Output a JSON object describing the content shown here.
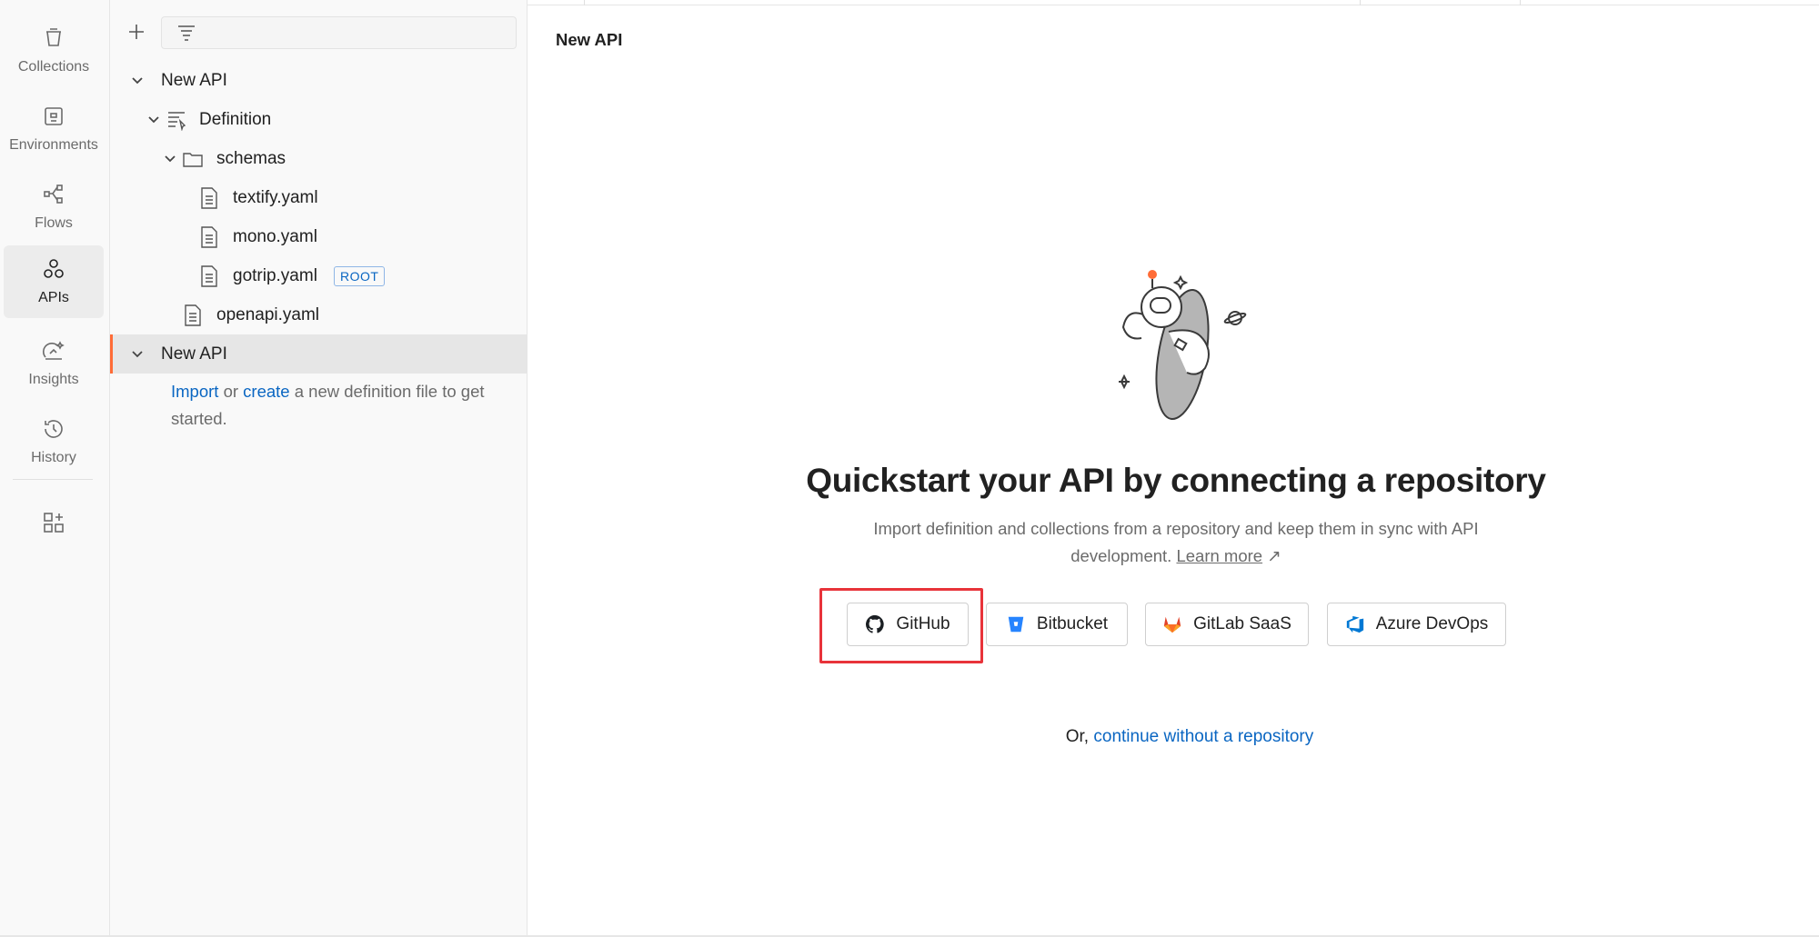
{
  "rail": {
    "items": [
      {
        "label": "Collections",
        "icon": "collections-icon"
      },
      {
        "label": "Environments",
        "icon": "environments-icon"
      },
      {
        "label": "Flows",
        "icon": "flows-icon"
      },
      {
        "label": "APIs",
        "icon": "apis-icon",
        "active": true
      },
      {
        "label": "Insights",
        "icon": "insights-icon"
      },
      {
        "label": "History",
        "icon": "history-icon"
      }
    ],
    "extra_icon": "add-workbench-icon"
  },
  "sidebar": {
    "filter_placeholder": "",
    "tree": [
      {
        "label": "New API",
        "expanded": true
      },
      {
        "label": "Definition",
        "expanded": true
      },
      {
        "label": "schemas",
        "expanded": true
      },
      {
        "label": "textify.yaml"
      },
      {
        "label": "mono.yaml"
      },
      {
        "label": "gotrip.yaml",
        "badge": "ROOT"
      },
      {
        "label": "openapi.yaml"
      },
      {
        "label": "New API",
        "expanded": true,
        "selected": true
      }
    ],
    "hint": {
      "import": "Import",
      "or": " or ",
      "create": "create",
      "rest": " a new definition file to get started."
    }
  },
  "main": {
    "title": "New API",
    "headline": "Quickstart your API by connecting a repository",
    "subtext": "Import definition and collections from a repository and keep them in sync with API development.",
    "learn_more": "Learn more",
    "learn_more_arrow": "↗",
    "buttons": [
      {
        "label": "GitHub",
        "icon": "github-icon"
      },
      {
        "label": "Bitbucket",
        "icon": "bitbucket-icon"
      },
      {
        "label": "GitLab SaaS",
        "icon": "gitlab-icon"
      },
      {
        "label": "Azure DevOps",
        "icon": "azure-devops-icon"
      }
    ],
    "or_text": "Or, ",
    "continue_link": "continue without a repository"
  },
  "colors": {
    "accent": "#ff6c37",
    "link": "#0a66c2",
    "highlight": "#e8333a"
  }
}
